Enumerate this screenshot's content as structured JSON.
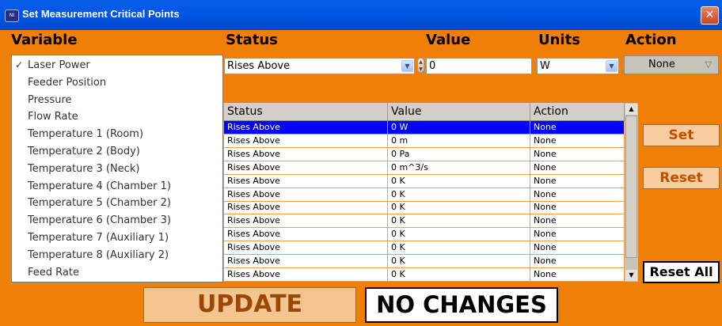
{
  "window": {
    "title": "Set Measurement Critical Points",
    "icon_name": "app-logo-icon",
    "close_glyph": "✕"
  },
  "headers": {
    "variable": "Variable",
    "status": "Status",
    "value": "Value",
    "units": "Units",
    "action": "Action"
  },
  "editor": {
    "status_value": "Rises Above",
    "value_value": "0",
    "units_value": "W",
    "action_value": "None"
  },
  "variables": {
    "selected_index": 0,
    "items": [
      "Laser Power",
      "Feeder Position",
      "Pressure",
      "Flow Rate",
      "Temperature 1 (Room)",
      "Temperature 2 (Body)",
      "Temperature 3 (Neck)",
      "Temperature 4 (Chamber 1)",
      "Temperature 5 (Chamber 2)",
      "Temperature 6 (Chamber 3)",
      "Temperature 7 (Auxiliary 1)",
      "Temperature 8 (Auxiliary 2)",
      "Feed Rate"
    ]
  },
  "table": {
    "columns": [
      "Status",
      "Value",
      "Action"
    ],
    "selected_row": 0,
    "rows": [
      [
        "Rises Above",
        "0 W",
        "None"
      ],
      [
        "Rises Above",
        "0 m",
        "None"
      ],
      [
        "Rises Above",
        "0 Pa",
        "None"
      ],
      [
        "Rises Above",
        "0 m^3/s",
        "None"
      ],
      [
        "Rises Above",
        "0 K",
        "None"
      ],
      [
        "Rises Above",
        "0 K",
        "None"
      ],
      [
        "Rises Above",
        "0 K",
        "None"
      ],
      [
        "Rises Above",
        "0 K",
        "None"
      ],
      [
        "Rises Above",
        "0 K",
        "None"
      ],
      [
        "Rises Above",
        "0 K",
        "None"
      ],
      [
        "Rises Above",
        "0 K",
        "None"
      ],
      [
        "Rises Above",
        "0 K",
        "None"
      ]
    ]
  },
  "buttons": {
    "set": "Set",
    "reset": "Reset",
    "reset_all": "Reset All",
    "update": "UPDATE",
    "no_changes": "NO CHANGES"
  },
  "colors": {
    "background": "#f07f08",
    "title_bar": "#0058e8",
    "selected_row": "#0303f8",
    "button_text": "#c05000"
  }
}
